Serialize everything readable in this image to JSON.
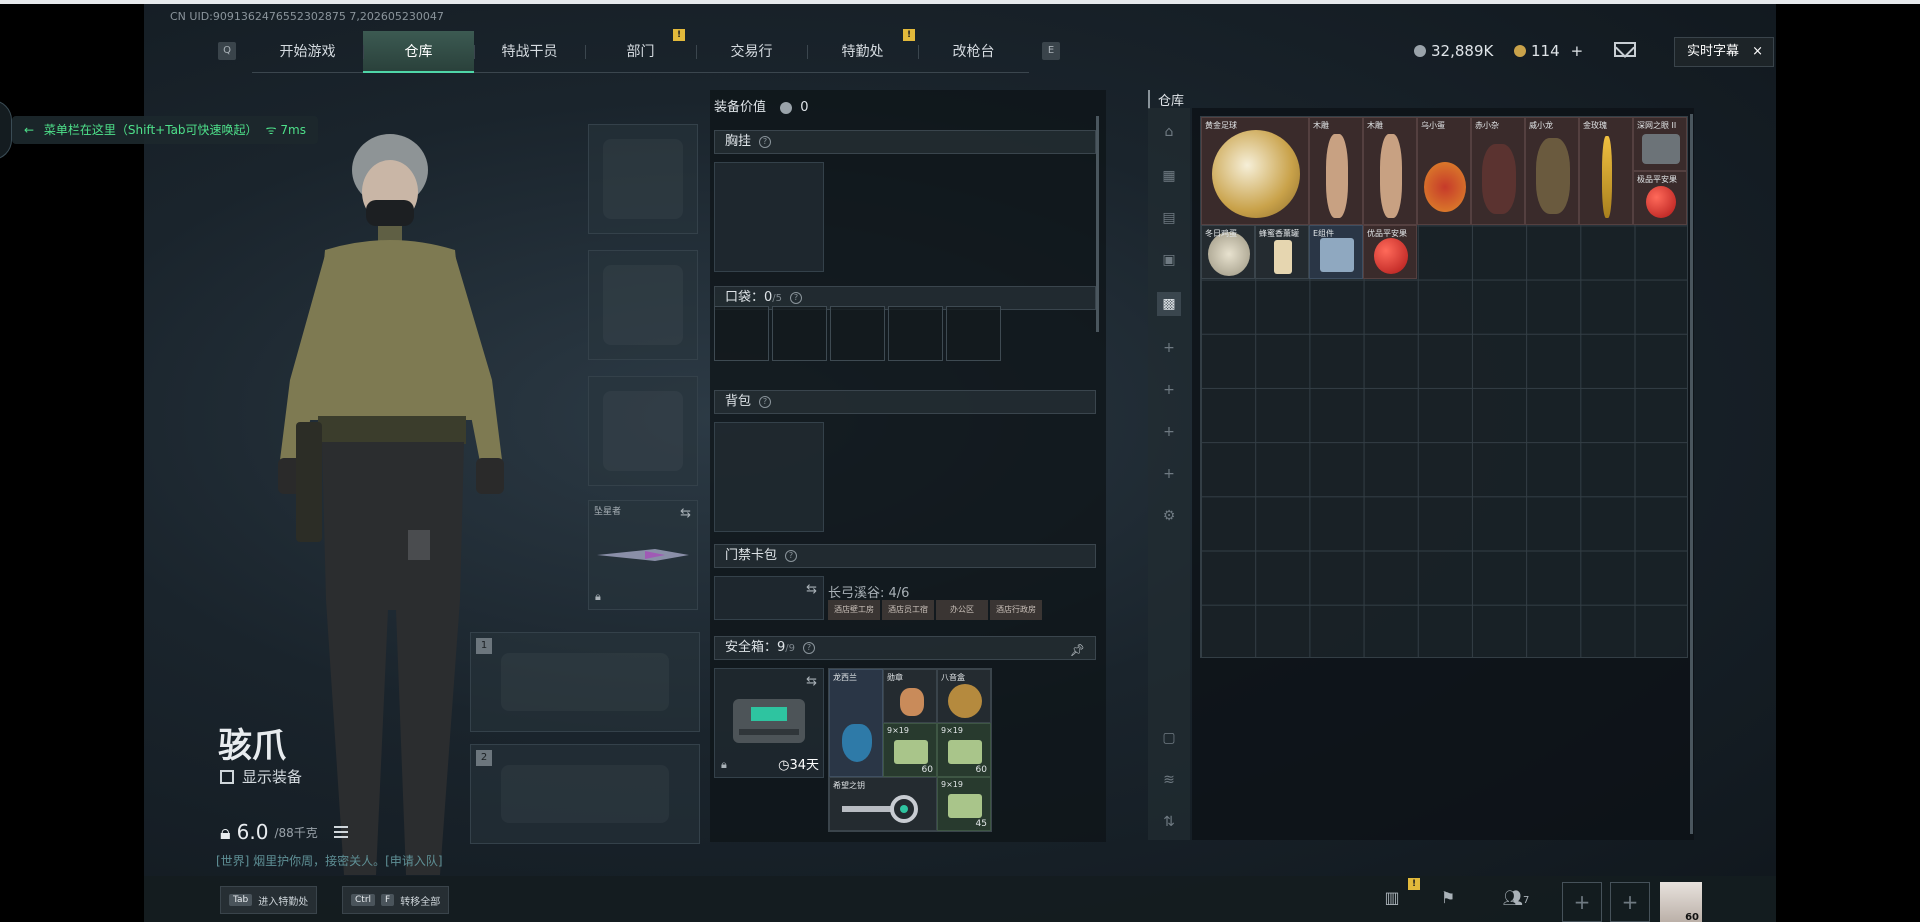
{
  "uid": "CN UID:9091362476552302875 7,202605230047",
  "nav": {
    "left_key": "Q",
    "right_key": "E",
    "tabs": [
      {
        "label": "开始游戏",
        "active": false,
        "badge": ""
      },
      {
        "label": "仓库",
        "active": true,
        "badge": ""
      },
      {
        "label": "特战干员",
        "active": false,
        "badge": ""
      },
      {
        "label": "部门",
        "active": false,
        "badge": "!"
      },
      {
        "label": "交易行",
        "active": false,
        "badge": ""
      },
      {
        "label": "特勤处",
        "active": false,
        "badge": "!"
      },
      {
        "label": "改枪台",
        "active": false,
        "badge": ""
      }
    ]
  },
  "currency": {
    "silver": "32,889K",
    "gold": "114",
    "gold_add": "+"
  },
  "subtitle_btn": {
    "label": "实时字幕",
    "close": "×"
  },
  "hint": {
    "arrow": "←",
    "text": "菜单栏在这里（Shift+Tab可快速唤起）",
    "ping": "7ms"
  },
  "character": {
    "name": "骇爪",
    "show_equip": "显示装备",
    "weight_value": "6.0",
    "weight_max": "/88千克",
    "chat": "[世界] 烟里护你周，接密关人。[申请入队]"
  },
  "slots": {
    "melee_label": "坠星者",
    "weapon1_num": "1",
    "weapon2_num": "2"
  },
  "loadout": {
    "value_label": "装备价值",
    "value": "0",
    "chest_label": "胸挂",
    "pocket_label": "口袋：",
    "pocket_count": "0",
    "pocket_max": "/5",
    "backpack_label": "背包",
    "card_label": "门禁卡包",
    "card_title": "长弓溪谷: 4/6",
    "card_tags": [
      "酒店壁工房",
      "酒店员工宿",
      "办公区",
      "酒店行政房"
    ],
    "safe_label": "安全箱：",
    "safe_count": "9",
    "safe_max": "/9",
    "safe_days": "34天",
    "safe_items": [
      {
        "name": "龙西兰",
        "count": ""
      },
      {
        "name": "勋章",
        "count": ""
      },
      {
        "name": "八音盒",
        "count": ""
      },
      {
        "name": "9×19",
        "count": "60"
      },
      {
        "name": "9×19",
        "count": "60"
      },
      {
        "name": "希望之钥",
        "count": ""
      },
      {
        "name": "9×19",
        "count": "45"
      }
    ]
  },
  "storage": {
    "title": "仓库",
    "items": [
      {
        "name": "黄金足球"
      },
      {
        "name": "木雕"
      },
      {
        "name": "木雕"
      },
      {
        "name": "乌小蛋"
      },
      {
        "name": "赤小杂"
      },
      {
        "name": "威小龙"
      },
      {
        "name": "金玫瑰"
      },
      {
        "name": "深网之眼 II"
      },
      {
        "name": "极品平安果"
      },
      {
        "name": "冬日鸡蛋"
      },
      {
        "name": "蜂蜜香薰罐"
      },
      {
        "name": "E组件"
      },
      {
        "name": "优品平安果"
      }
    ]
  },
  "bottom": {
    "tab_key": "Tab",
    "tab_label": "进入特勤处",
    "ctrl_key": "Ctrl",
    "f_key": "F",
    "transfer_label": "转移全部",
    "badge": "!",
    "friends_count": "7",
    "avatar_level": "60"
  }
}
